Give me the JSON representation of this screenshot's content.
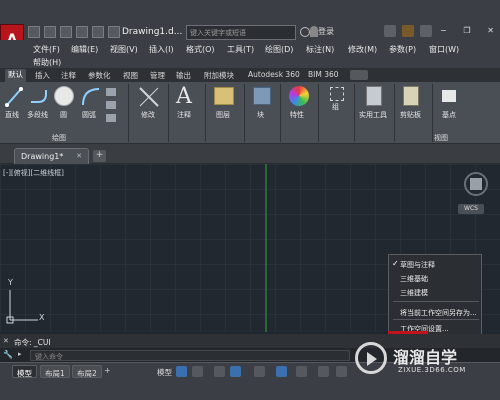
{
  "titlebar": {
    "app_letter": "A",
    "doc_title": "Drawing1.d...",
    "search_placeholder": "键入关键字或短语",
    "login": "登录"
  },
  "menu": [
    "文件(F)",
    "编辑(E)",
    "视图(V)",
    "插入(I)",
    "格式(O)",
    "工具(T)",
    "绘图(D)",
    "标注(N)",
    "修改(M)",
    "参数(P)",
    "窗口(W)",
    "帮助(H)"
  ],
  "ribbon_tabs": [
    "默认",
    "插入",
    "注释",
    "参数化",
    "视图",
    "管理",
    "输出",
    "附加模块",
    "Autodesk 360",
    "BIM 360"
  ],
  "ribbon": {
    "draw_tools": [
      "直线",
      "多段线",
      "圆",
      "圆弧"
    ],
    "panels": [
      "修改",
      "注释",
      "图层",
      "块",
      "特性",
      "组",
      "实用工具",
      "剪贴板",
      "基点"
    ],
    "panel_labels": {
      "draw": "绘图",
      "view": "视图"
    }
  },
  "file_tab": "Drawing1*",
  "file_tab_plus": "+",
  "canvas": {
    "view_label": "[-][俯视][二维线框]",
    "wcs": "WCS",
    "axis_x": "X",
    "axis_y": "Y"
  },
  "context_menu": {
    "items": [
      "草图与注释",
      "三维基础",
      "三维建模",
      "将当前工作空间另存为...",
      "工作空间设置..."
    ],
    "checked": "草图与注释"
  },
  "command": {
    "history": "命令: _CUI",
    "placeholder": "键入命令"
  },
  "layout_tabs": [
    "模型",
    "布局1",
    "布局2"
  ],
  "status": {
    "model": "模型"
  },
  "watermark": {
    "title": "溜溜自学",
    "url": "ZIXUE.3D66.COM"
  },
  "colors": {
    "app_red": "#b8141c",
    "canvas": "#212830",
    "ribbon": "#4a4e55",
    "green_axis": "#2fa83a"
  }
}
